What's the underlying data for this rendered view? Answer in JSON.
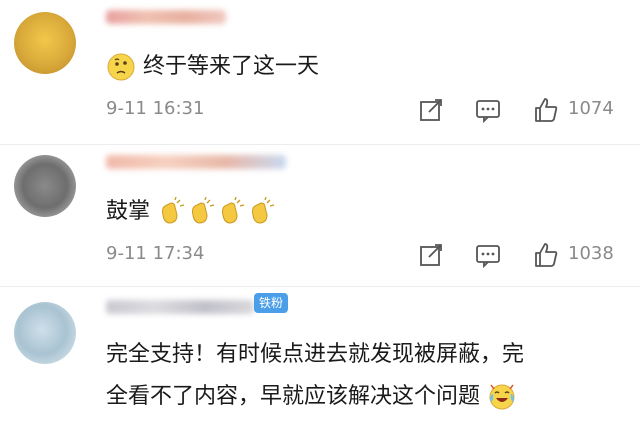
{
  "comments": [
    {
      "text": "终于等来了这一天",
      "time": "9-11 16:31",
      "likes": "1074",
      "emojis_inline": [
        "thinking-face"
      ]
    },
    {
      "text": "鼓掌",
      "time": "9-11 17:34",
      "likes": "1038",
      "emojis_inline": [
        "clapping-hands",
        "clapping-hands",
        "clapping-hands",
        "clapping-hands"
      ]
    },
    {
      "badge": "铁粉",
      "text_line1": "完全支持！有时候点进去就发现被屏蔽，完",
      "text_line2": "全看不了内容，早就应该解决这个问题",
      "emojis_inline": [
        "crying-laughing-face"
      ]
    }
  ],
  "colors": {
    "text": "#1a1a1a",
    "meta": "#8a8a8a",
    "badge": "#4a9fe8",
    "divider": "#ececec"
  }
}
